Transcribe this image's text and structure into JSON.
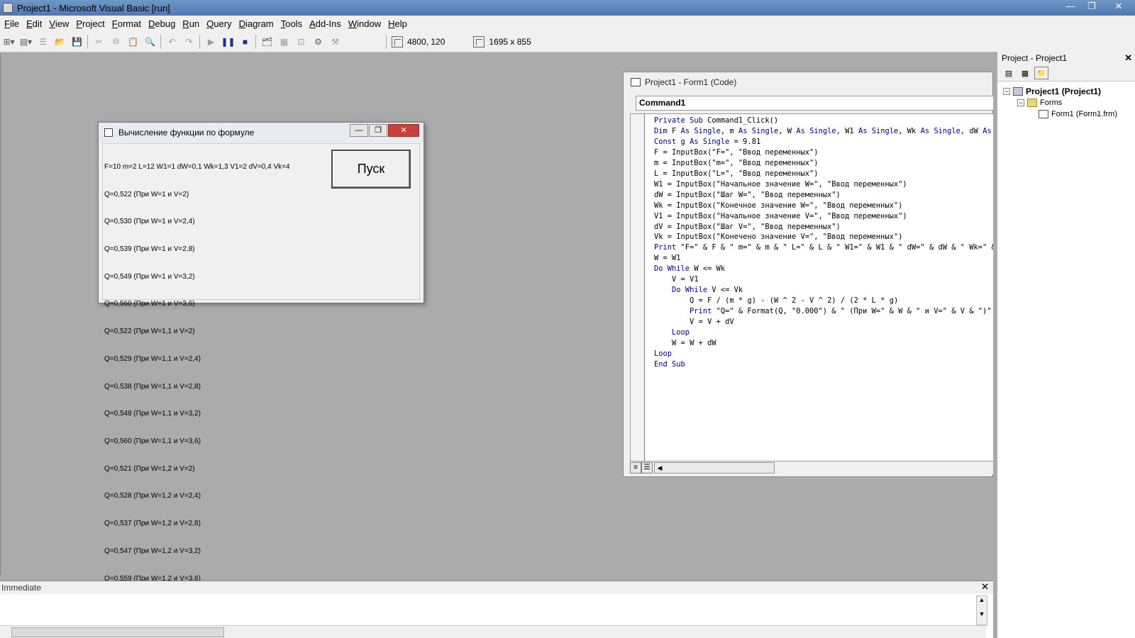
{
  "app": {
    "title": "Project1 - Microsoft Visual Basic [run]",
    "window_buttons": {
      "minimize": "—",
      "restore": "❐",
      "close": "✕"
    }
  },
  "menu": [
    "File",
    "Edit",
    "View",
    "Project",
    "Format",
    "Debug",
    "Run",
    "Query",
    "Diagram",
    "Tools",
    "Add-Ins",
    "Window",
    "Help"
  ],
  "toolbar": {
    "position": "4800, 120",
    "size": "1695 x 855"
  },
  "form_window": {
    "title": "Вычисление функции по формуле",
    "button_label": "Пуск",
    "output_lines": [
      "F=10 m=2 L=12 W1=1 dW=0,1 Wk=1,3 V1=2 dV=0,4 Vk=4",
      "Q=0,522 (При W=1 и V=2)",
      "Q=0,530 (При W=1 и V=2,4)",
      "Q=0,539 (При W=1 и V=2,8)",
      "Q=0,549 (При W=1 и V=3,2)",
      "Q=0,560 (При W=1 и V=3,6)",
      "Q=0,522 (При W=1,1 и V=2)",
      "Q=0,529 (При W=1,1 и V=2,4)",
      "Q=0,538 (При W=1,1 и V=2,8)",
      "Q=0,548 (При W=1,1 и V=3,2)",
      "Q=0,560 (При W=1,1 и V=3,6)",
      "Q=0,521 (При W=1,2 и V=2)",
      "Q=0,528 (При W=1,2 и V=2,4)",
      "Q=0,537 (При W=1,2 и V=2,8)",
      "Q=0,547 (При W=1,2 и V=3,2)",
      "Q=0,559 (При W=1,2 и V=3,6)"
    ]
  },
  "code_window": {
    "title": "Project1 - Form1 (Code)",
    "object_combo": "Command1",
    "lines": [
      "Private Sub Command1_Click()",
      "Dim F As Single, m As Single, W As Single, W1 As Single, Wk As Single, dW As Single, V",
      "Const g As Single = 9.81",
      "F = InputBox(\"F=\", \"Ввод переменных\")",
      "m = InputBox(\"m=\", \"Ввод переменных\")",
      "L = InputBox(\"L=\", \"Ввод переменных\")",
      "W1 = InputBox(\"Начальное значение W=\", \"Ввод переменных\")",
      "dW = InputBox(\"Шаг W=\", \"Ввод переменных\")",
      "Wk = InputBox(\"Конечное значение W=\", \"Ввод переменных\")",
      "V1 = InputBox(\"Начальное значение V=\", \"Ввод переменных\")",
      "dV = InputBox(\"Шаг V=\", \"Ввод переменных\")",
      "Vk = InputBox(\"Конечено значение V=\", \"Ввод переменных\")",
      "Print \"F=\" & F & \" m=\" & m & \" L=\" & L & \" W1=\" & W1 & \" dW=\" & dW & \" Wk=\" & Wk &",
      "W = W1",
      "Do While W <= Wk",
      "    V = V1",
      "    Do While V <= Vk",
      "        Q = F / (m * g) - (W ^ 2 - V ^ 2) / (2 * L * g)",
      "        Print \"Q=\" & Format(Q, \"0.000\") & \" (При W=\" & W & \" и V=\" & V & \")\"",
      "        V = V + dV",
      "    Loop",
      "    W = W + dW",
      "Loop",
      "End Sub"
    ]
  },
  "project_explorer": {
    "title": "Project - Project1",
    "root": "Project1 (Project1)",
    "folder": "Forms",
    "item": "Form1 (Form1.frm)"
  },
  "immediate": {
    "title": "Immediate"
  }
}
